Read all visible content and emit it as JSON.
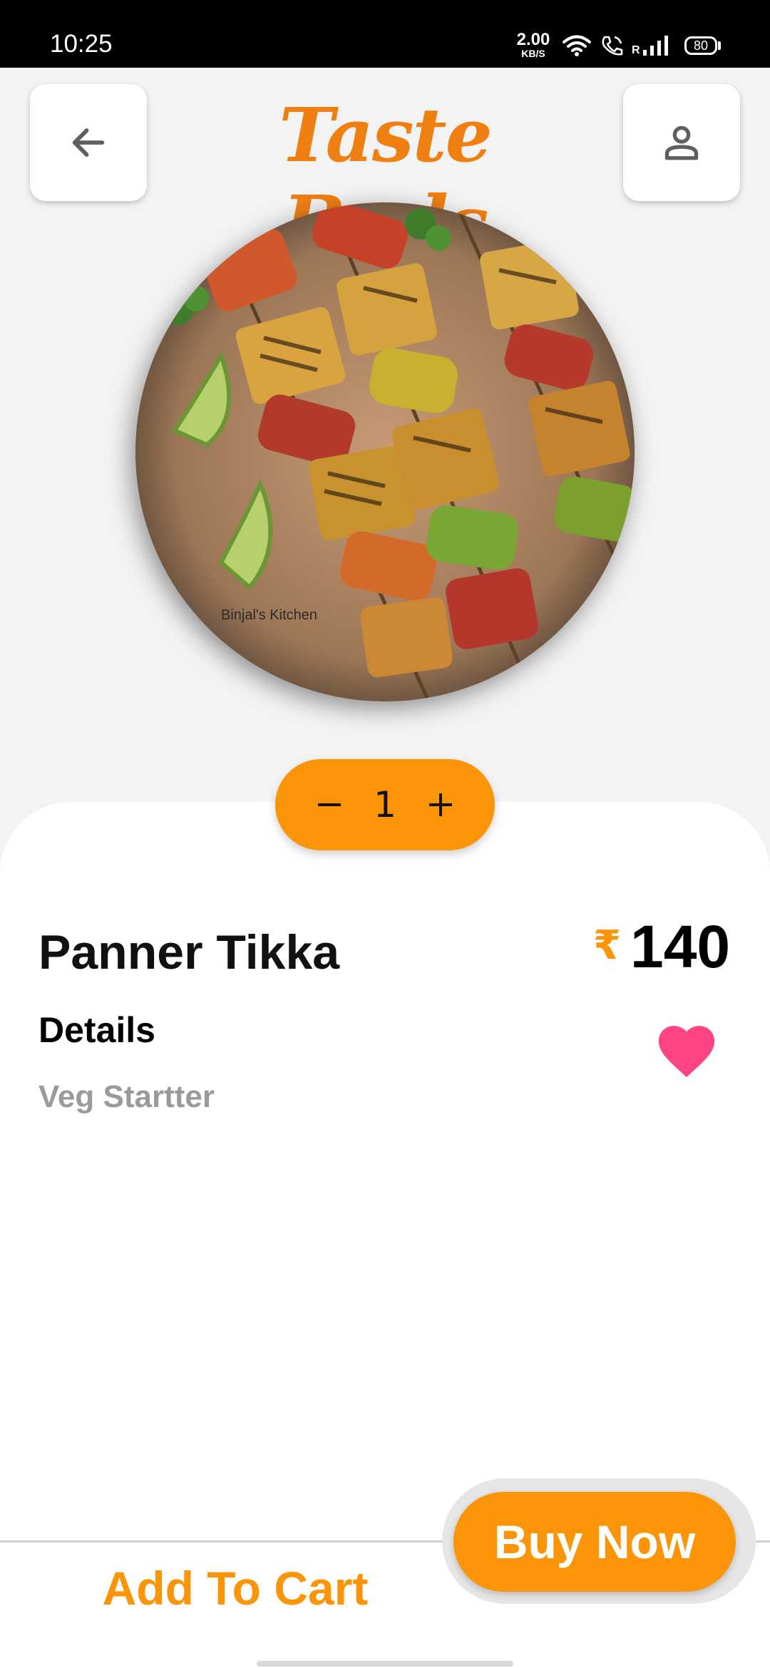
{
  "status_bar": {
    "time": "10:25",
    "net_speed_value": "2.00",
    "net_speed_unit": "KB/S",
    "roaming_label": "R",
    "battery": "80"
  },
  "header": {
    "title": "Taste Buds",
    "back_icon": "arrow-left-icon",
    "profile_icon": "person-icon"
  },
  "product": {
    "image_icon": "paneer-tikka-skewers-photo",
    "watermark": "Binjal's Kitchen",
    "quantity": "1",
    "name": "Panner Tikka",
    "currency": "₹",
    "price": "140",
    "details_heading": "Details",
    "details_text": "Veg Startter",
    "favorite": true
  },
  "actions": {
    "add_to_cart": "Add To Cart",
    "buy_now": "Buy Now"
  },
  "colors": {
    "accent": "#fb9406",
    "title": "#f07f12",
    "favorite": "#ff4383"
  }
}
